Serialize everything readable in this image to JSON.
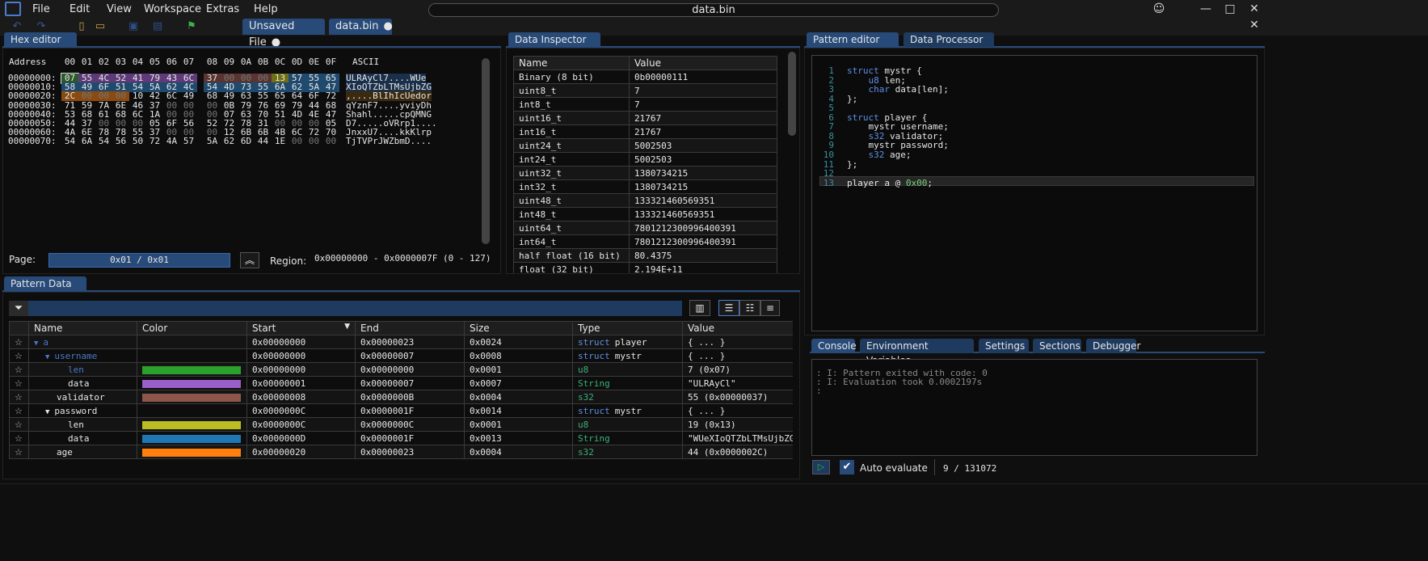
{
  "menu": [
    "File",
    "Edit",
    "View",
    "Workspace",
    "Extras",
    "Help"
  ],
  "window_title": "data.bin",
  "file_tabs": [
    {
      "label": "Unsaved File",
      "dot": "●"
    },
    {
      "label": "data.bin",
      "dot": "●"
    }
  ],
  "window_buttons": {
    "smiley": "☺",
    "minimize": "—",
    "maximize": "□",
    "close": "✕",
    "close2": "✕"
  },
  "toolbar_icons": [
    "undo-icon",
    "redo-icon",
    "new-file-icon",
    "open-folder-icon",
    "save-icon",
    "save-as-icon",
    "bookmark-icon"
  ],
  "hex_editor": {
    "tab": "Hex editor",
    "header_address": "Address",
    "header_cols": [
      "00",
      "01",
      "02",
      "03",
      "04",
      "05",
      "06",
      "07",
      "08",
      "09",
      "0A",
      "0B",
      "0C",
      "0D",
      "0E",
      "0F"
    ],
    "header_ascii": "ASCII",
    "rows": [
      {
        "addr": "00000000:",
        "bytes": [
          "07",
          "55",
          "4C",
          "52",
          "41",
          "79",
          "43",
          "6C",
          "37",
          "00",
          "00",
          "00",
          "13",
          "57",
          "55",
          "65"
        ],
        "ascii": "ULRAyCl7....WUe"
      },
      {
        "addr": "00000010:",
        "bytes": [
          "58",
          "49",
          "6F",
          "51",
          "54",
          "5A",
          "62",
          "4C",
          "54",
          "4D",
          "73",
          "55",
          "6A",
          "62",
          "5A",
          "47"
        ],
        "ascii": "XIoQTZbLTMsUjbZG"
      },
      {
        "addr": "00000020:",
        "bytes": [
          "2C",
          "00",
          "00",
          "00",
          "10",
          "42",
          "6C",
          "49",
          "68",
          "49",
          "63",
          "55",
          "65",
          "64",
          "6F",
          "72"
        ],
        "ascii": ",....BlIhIcUedor"
      },
      {
        "addr": "00000030:",
        "bytes": [
          "71",
          "59",
          "7A",
          "6E",
          "46",
          "37",
          "00",
          "00",
          "00",
          "0B",
          "79",
          "76",
          "69",
          "79",
          "44",
          "68"
        ],
        "ascii": "qYznF7....yviyDh"
      },
      {
        "addr": "00000040:",
        "bytes": [
          "53",
          "68",
          "61",
          "68",
          "6C",
          "1A",
          "00",
          "00",
          "00",
          "07",
          "63",
          "70",
          "51",
          "4D",
          "4E",
          "47"
        ],
        "ascii": "Shahl.....cpQMNG"
      },
      {
        "addr": "00000050:",
        "bytes": [
          "44",
          "37",
          "00",
          "00",
          "00",
          "05",
          "6F",
          "56",
          "52",
          "72",
          "78",
          "31",
          "00",
          "00",
          "00",
          "05"
        ],
        "ascii": "D7.....oVRrp1...."
      },
      {
        "addr": "00000060:",
        "bytes": [
          "4A",
          "6E",
          "78",
          "78",
          "55",
          "37",
          "00",
          "00",
          "00",
          "12",
          "6B",
          "6B",
          "4B",
          "6C",
          "72",
          "70"
        ],
        "ascii": "JnxxU7....kkKlrp"
      },
      {
        "addr": "00000070:",
        "bytes": [
          "54",
          "6A",
          "54",
          "56",
          "50",
          "72",
          "4A",
          "57",
          "5A",
          "62",
          "6D",
          "44",
          "1E",
          "00",
          "00",
          "00"
        ],
        "ascii": "TjTVPrJWZbmD...."
      }
    ],
    "page_label": "Page:",
    "page_value": "0x01 / 0x01",
    "region_label": "Region:",
    "region_value": "0x00000000 - 0x0000007F (0 - 127)"
  },
  "data_inspector": {
    "tab": "Data Inspector",
    "col_name": "Name",
    "col_value": "Value",
    "rows": [
      [
        "Binary (8 bit)",
        "0b00000111"
      ],
      [
        "uint8_t",
        "7"
      ],
      [
        "int8_t",
        "7"
      ],
      [
        "uint16_t",
        "21767"
      ],
      [
        "int16_t",
        "21767"
      ],
      [
        "uint24_t",
        "5002503"
      ],
      [
        "int24_t",
        "5002503"
      ],
      [
        "uint32_t",
        "1380734215"
      ],
      [
        "int32_t",
        "1380734215"
      ],
      [
        "uint48_t",
        "133321460569351"
      ],
      [
        "int48_t",
        "133321460569351"
      ],
      [
        "uint64_t",
        "7801212300996400391"
      ],
      [
        "int64_t",
        "7801212300996400391"
      ],
      [
        "half float (16 bit)",
        "80.4375"
      ],
      [
        "float (32 bit)",
        "2.194E+11"
      ]
    ]
  },
  "pattern_editor": {
    "tabs": [
      "Pattern editor",
      "Data Processor"
    ],
    "lines": [
      {
        "n": "1",
        "t": "struct mystr {"
      },
      {
        "n": "2",
        "t": "    u8 len;"
      },
      {
        "n": "3",
        "t": "    char data[len];"
      },
      {
        "n": "4",
        "t": "};"
      },
      {
        "n": "5",
        "t": ""
      },
      {
        "n": "6",
        "t": "struct player {"
      },
      {
        "n": "7",
        "t": "    mystr username;"
      },
      {
        "n": "8",
        "t": "    s32 validator;"
      },
      {
        "n": "9",
        "t": "    mystr password;"
      },
      {
        "n": "10",
        "t": "    s32 age;"
      },
      {
        "n": "11",
        "t": "};"
      },
      {
        "n": "12",
        "t": ""
      },
      {
        "n": "13",
        "t": "player a @ 0x00;"
      }
    ]
  },
  "console": {
    "tabs": [
      "Console",
      "Environment Variables",
      "Settings",
      "Sections",
      "Debugger"
    ],
    "lines": [
      "I: Pattern exited with code: 0",
      "I: Evaluation took 0.0002197s"
    ],
    "auto_evaluate": "Auto evaluate",
    "progress": "9 / 131072"
  },
  "pattern_data": {
    "tab": "Pattern Data",
    "columns": [
      "Name",
      "Color",
      "Start",
      "End",
      "Size",
      "Type",
      "Value"
    ],
    "rows": [
      {
        "indent": 0,
        "arrow": "▼",
        "name": "a",
        "color": "",
        "start": "0x00000000",
        "end": "0x00000023",
        "size": "0x0024",
        "type_kw": "struct",
        "type_name": "player",
        "value": "{ ... }",
        "hl": true
      },
      {
        "indent": 1,
        "arrow": "▼",
        "name": "username",
        "color": "",
        "start": "0x00000000",
        "end": "0x00000007",
        "size": "0x0008",
        "type_kw": "struct",
        "type_name": "mystr",
        "value": "{ ... }",
        "hl": true
      },
      {
        "indent": 2,
        "arrow": "",
        "name": "len",
        "color": "#2ca02c",
        "start": "0x00000000",
        "end": "0x00000000",
        "size": "0x0001",
        "type_kw": "",
        "type_name": "u8",
        "value": "7 (0x07)",
        "hl": true
      },
      {
        "indent": 2,
        "arrow": "",
        "name": "data",
        "color": "#9a5fc8",
        "start": "0x00000001",
        "end": "0x00000007",
        "size": "0x0007",
        "type_kw": "",
        "type_name": "String",
        "value": "\"ULRAyCl\"",
        "hl": false
      },
      {
        "indent": 1,
        "arrow": "",
        "name": "validator",
        "color": "#8c564b",
        "start": "0x00000008",
        "end": "0x0000000B",
        "size": "0x0004",
        "type_kw": "",
        "type_name": "s32",
        "value": "55 (0x00000037)",
        "hl": false
      },
      {
        "indent": 1,
        "arrow": "▼",
        "name": "password",
        "color": "",
        "start": "0x0000000C",
        "end": "0x0000001F",
        "size": "0x0014",
        "type_kw": "struct",
        "type_name": "mystr",
        "value": "{ ... }",
        "hl": false
      },
      {
        "indent": 2,
        "arrow": "",
        "name": "len",
        "color": "#bcbd22",
        "start": "0x0000000C",
        "end": "0x0000000C",
        "size": "0x0001",
        "type_kw": "",
        "type_name": "u8",
        "value": "19 (0x13)",
        "hl": false
      },
      {
        "indent": 2,
        "arrow": "",
        "name": "data",
        "color": "#1f77b4",
        "start": "0x0000000D",
        "end": "0x0000001F",
        "size": "0x0013",
        "type_kw": "",
        "type_name": "String",
        "value": "\"WUeXIoQTZbLTMsUjbZG\"",
        "hl": false
      },
      {
        "indent": 1,
        "arrow": "",
        "name": "age",
        "color": "#ff7f0e",
        "start": "0x00000020",
        "end": "0x00000023",
        "size": "0x0004",
        "type_kw": "",
        "type_name": "s32",
        "value": "44 (0x0000002C)",
        "hl": false
      }
    ]
  }
}
